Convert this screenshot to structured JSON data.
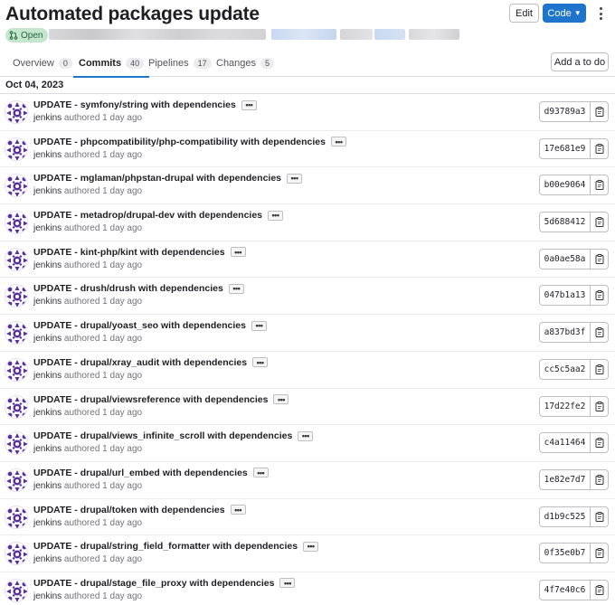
{
  "header": {
    "title": "Automated packages update",
    "status": "Open",
    "edit_label": "Edit",
    "code_label": "Code"
  },
  "tabs": [
    {
      "label": "Overview",
      "count": "0",
      "active": false
    },
    {
      "label": "Commits",
      "count": "40",
      "active": true
    },
    {
      "label": "Pipelines",
      "count": "17",
      "active": false
    },
    {
      "label": "Changes",
      "count": "5",
      "active": false
    }
  ],
  "todo_label": "Add a to do",
  "date": "Oct 04, 2023",
  "colors": {
    "accent": "#1f75cb",
    "badge_bg": "#c3e6cd",
    "badge_fg": "#24663b",
    "avatar": "#5c2f9e"
  },
  "icons": {
    "more": "ellipsis-icon",
    "copy": "clipboard-icon",
    "merge": "merge-request-icon"
  },
  "commits": [
    {
      "message": "UPDATE - symfony/string with dependencies",
      "author": "jenkins",
      "time": "authored 1 day ago",
      "sha": "d93789a3"
    },
    {
      "message": "UPDATE - phpcompatibility/php-compatibility with dependencies",
      "author": "jenkins",
      "time": "authored 1 day ago",
      "sha": "17e681e9"
    },
    {
      "message": "UPDATE - mglaman/phpstan-drupal with dependencies",
      "author": "jenkins",
      "time": "authored 1 day ago",
      "sha": "b00e9064"
    },
    {
      "message": "UPDATE - metadrop/drupal-dev with dependencies",
      "author": "jenkins",
      "time": "authored 1 day ago",
      "sha": "5d688412"
    },
    {
      "message": "UPDATE - kint-php/kint with dependencies",
      "author": "jenkins",
      "time": "authored 1 day ago",
      "sha": "0a0ae58a"
    },
    {
      "message": "UPDATE - drush/drush with dependencies",
      "author": "jenkins",
      "time": "authored 1 day ago",
      "sha": "047b1a13"
    },
    {
      "message": "UPDATE - drupal/yoast_seo with dependencies",
      "author": "jenkins",
      "time": "authored 1 day ago",
      "sha": "a837bd3f"
    },
    {
      "message": "UPDATE - drupal/xray_audit with dependencies",
      "author": "jenkins",
      "time": "authored 1 day ago",
      "sha": "cc5c5aa2"
    },
    {
      "message": "UPDATE - drupal/viewsreference with dependencies",
      "author": "jenkins",
      "time": "authored 1 day ago",
      "sha": "17d22fe2"
    },
    {
      "message": "UPDATE - drupal/views_infinite_scroll with dependencies",
      "author": "jenkins",
      "time": "authored 1 day ago",
      "sha": "c4a11464"
    },
    {
      "message": "UPDATE - drupal/url_embed with dependencies",
      "author": "jenkins",
      "time": "authored 1 day ago",
      "sha": "1e82e7d7"
    },
    {
      "message": "UPDATE - drupal/token with dependencies",
      "author": "jenkins",
      "time": "authored 1 day ago",
      "sha": "d1b9c525"
    },
    {
      "message": "UPDATE - drupal/string_field_formatter with dependencies",
      "author": "jenkins",
      "time": "authored 1 day ago",
      "sha": "0f35e0b7"
    },
    {
      "message": "UPDATE - drupal/stage_file_proxy with dependencies",
      "author": "jenkins",
      "time": "authored 1 day ago",
      "sha": "4f7e40c6"
    }
  ]
}
